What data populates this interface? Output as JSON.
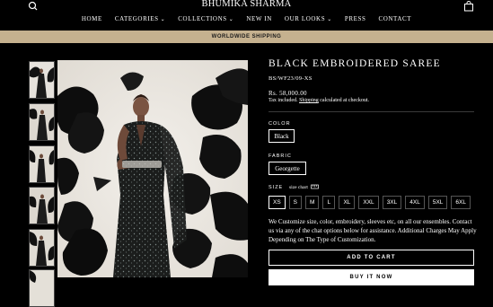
{
  "header": {
    "brand": "BHUMIKA SHARMA",
    "search_icon": "search-icon",
    "cart_icon": "shopping-bag-icon",
    "nav": [
      {
        "label": "HOME",
        "has_dropdown": false
      },
      {
        "label": "CATEGORIES",
        "has_dropdown": true
      },
      {
        "label": "COLLECTIONS",
        "has_dropdown": true
      },
      {
        "label": "NEW IN",
        "has_dropdown": false
      },
      {
        "label": "OUR LOOKS",
        "has_dropdown": true
      },
      {
        "label": "PRESS",
        "has_dropdown": false
      },
      {
        "label": "CONTACT",
        "has_dropdown": false
      }
    ]
  },
  "announcement": {
    "text": "WORLDWIDE SHIPPING"
  },
  "gallery": {
    "thumbnail_count": 6
  },
  "product": {
    "title": "BLACK EMBROIDERED SAREE",
    "sku": "BS/WF23/09-XS",
    "price": "Rs. 58,000.00",
    "tax_prefix": "Tax included.",
    "tax_link": "Shipping",
    "tax_suffix": "calculated at checkout.",
    "color": {
      "label": "COLOR",
      "value": "Black"
    },
    "fabric": {
      "label": "FABRIC",
      "value": "Georgette"
    },
    "size": {
      "label": "SIZE",
      "chart_link": "size chart",
      "chart_icon": "ruler-icon",
      "options": [
        "XS",
        "S",
        "M",
        "L",
        "XL",
        "XXL",
        "3XL",
        "4XL",
        "5XL",
        "6XL"
      ],
      "selected": "XS"
    },
    "custom_note": "We Customize size, color, embroidery, sleeves etc, on all our ensembles. Contact us via any of the chat options below for assistance. Additional Charges May Apply Depending on The Type of Customization.",
    "add_to_cart": "ADD TO CART",
    "buy_now": "BUY IT NOW"
  },
  "colors": {
    "background": "#000000",
    "accent_bar": "#c5b18f",
    "text": "#ffffff"
  }
}
